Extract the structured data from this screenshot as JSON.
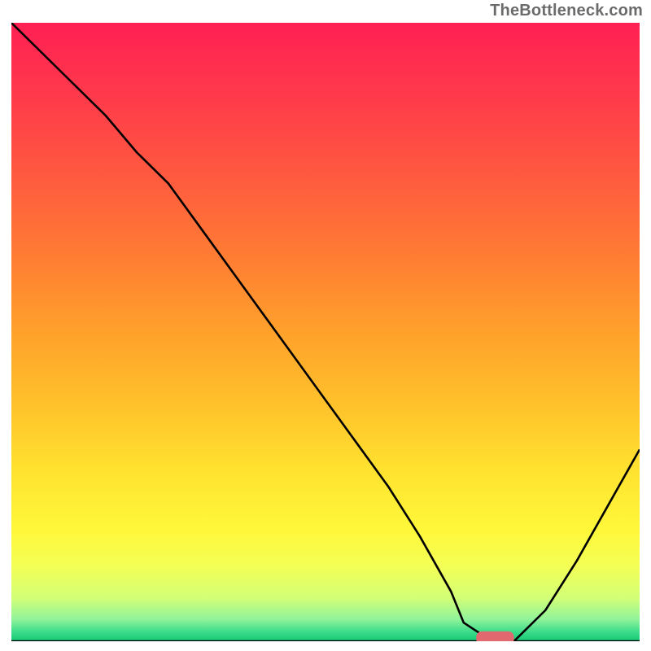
{
  "watermark": "TheBottleneck.com",
  "chart_data": {
    "type": "line",
    "title": "",
    "xlabel": "",
    "ylabel": "",
    "ylim": [
      0,
      100
    ],
    "xlim": [
      0,
      100
    ],
    "grid": false,
    "legend": false,
    "series": [
      {
        "name": "bottleneck-curve",
        "kind": "line",
        "x": [
          0,
          5,
          10,
          15,
          20,
          25,
          30,
          35,
          40,
          45,
          50,
          55,
          60,
          65,
          70,
          72,
          75,
          78,
          80,
          85,
          90,
          95,
          100
        ],
        "y": [
          100,
          95,
          90,
          85,
          79,
          74,
          67,
          60,
          53,
          46,
          39,
          32,
          25,
          17,
          8,
          3,
          1,
          0,
          0,
          5,
          13,
          22,
          31
        ]
      },
      {
        "name": "marker",
        "kind": "marker",
        "x": 77,
        "y": 0.5,
        "width": 6,
        "height": 2.2,
        "color": "#e2686f"
      }
    ],
    "gradient_stops": [
      {
        "offset": 0.0,
        "color": "#ff2053"
      },
      {
        "offset": 0.12,
        "color": "#ff3a4b"
      },
      {
        "offset": 0.25,
        "color": "#ff5a3f"
      },
      {
        "offset": 0.38,
        "color": "#ff7d33"
      },
      {
        "offset": 0.5,
        "color": "#ffa12b"
      },
      {
        "offset": 0.62,
        "color": "#ffc22b"
      },
      {
        "offset": 0.72,
        "color": "#ffe12f"
      },
      {
        "offset": 0.82,
        "color": "#fff83a"
      },
      {
        "offset": 0.88,
        "color": "#f3ff56"
      },
      {
        "offset": 0.93,
        "color": "#d2ff77"
      },
      {
        "offset": 0.965,
        "color": "#8ff39a"
      },
      {
        "offset": 0.985,
        "color": "#3bdc8a"
      },
      {
        "offset": 1.0,
        "color": "#14c873"
      }
    ],
    "axis_line_color": "#000000",
    "baseline_y": 0,
    "baseline_color": "#000000",
    "baseline_stroke_width": 2.5
  }
}
